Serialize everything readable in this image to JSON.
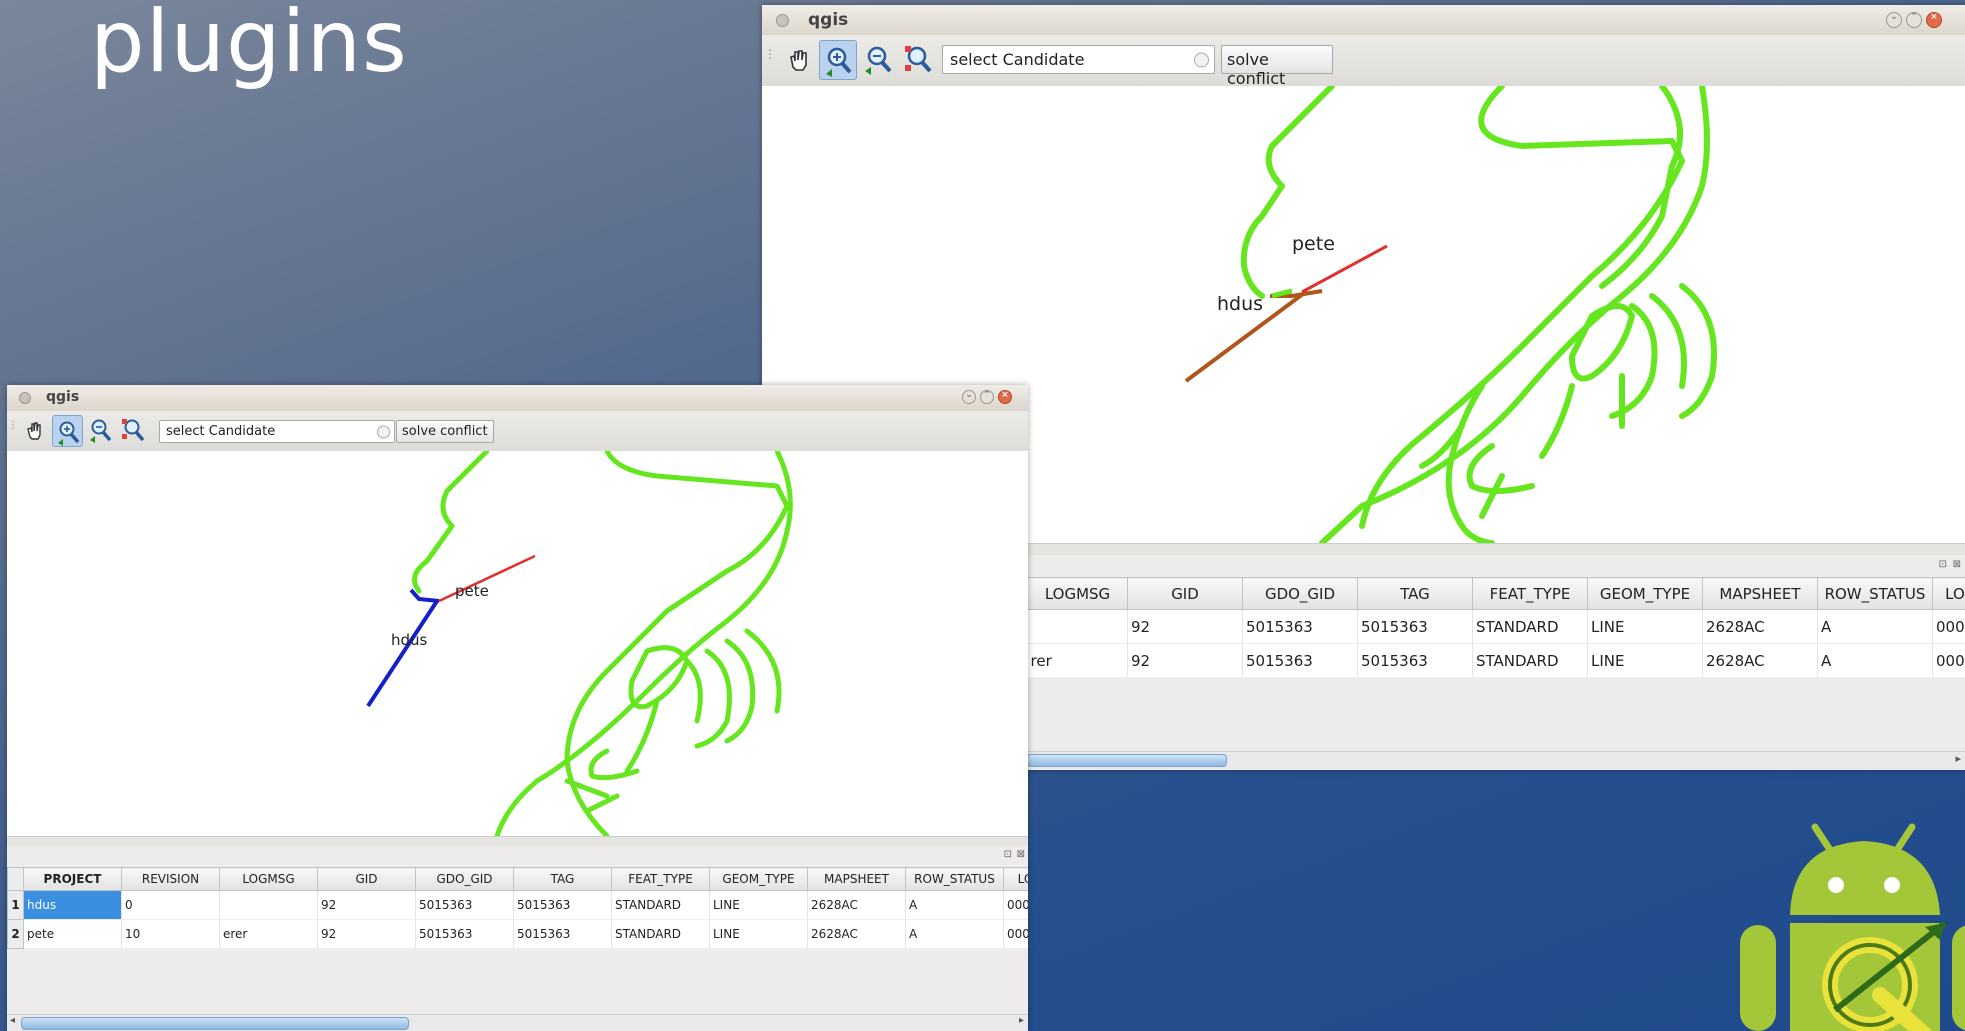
{
  "slide": {
    "title": "plugins"
  },
  "back_window": {
    "title": "qgis",
    "toolbar": {
      "combo_value": "select Candidate",
      "solve_button": "solve conflict"
    },
    "map": {
      "label_a": "pete",
      "label_b": "hdus"
    },
    "table": {
      "columns": [
        "LOGMSG",
        "GID",
        "GDO_GID",
        "TAG",
        "FEAT_TYPE",
        "GEOM_TYPE",
        "MAPSHEET",
        "ROW_STATUS",
        "LO"
      ],
      "rows": [
        [
          "",
          "92",
          "5015363",
          "5015363",
          "STANDARD",
          "LINE",
          "2628AC",
          "A",
          "000"
        ],
        [
          "rer",
          "92",
          "5015363",
          "5015363",
          "STANDARD",
          "LINE",
          "2628AC",
          "A",
          "000"
        ]
      ]
    }
  },
  "front_window": {
    "title": "qgis",
    "toolbar": {
      "combo_value": "select Candidate",
      "solve_button": "solve conflict"
    },
    "map": {
      "label_a": "pete",
      "label_b": "hdus"
    },
    "table": {
      "columns": [
        "PROJECT",
        "REVISION",
        "LOGMSG",
        "GID",
        "GDO_GID",
        "TAG",
        "FEAT_TYPE",
        "GEOM_TYPE",
        "MAPSHEET",
        "ROW_STATUS",
        "LO"
      ],
      "row_headers": [
        "1",
        "2"
      ],
      "rows": [
        [
          "hdus",
          "0",
          "",
          "92",
          "5015363",
          "5015363",
          "STANDARD",
          "LINE",
          "2628AC",
          "A",
          "000"
        ],
        [
          "pete",
          "10",
          "erer",
          "92",
          "5015363",
          "5015363",
          "STANDARD",
          "LINE",
          "2628AC",
          "A",
          "000"
        ]
      ]
    }
  },
  "colors": {
    "map_lines": "#66e61e",
    "conflict_red": "#e03030",
    "front_candidate": "#1520c8",
    "back_candidate": "#b0561a",
    "selection": "#3a8fe0",
    "android_green": "#a4c639"
  },
  "icons": [
    "pan-icon",
    "zoom-in-icon",
    "zoom-out-icon",
    "zoom-full-icon",
    "combo-arrow-icon",
    "minimize-icon",
    "maximize-icon",
    "close-icon",
    "dock-float-icon",
    "dock-close-icon",
    "android-qgis-logo"
  ]
}
